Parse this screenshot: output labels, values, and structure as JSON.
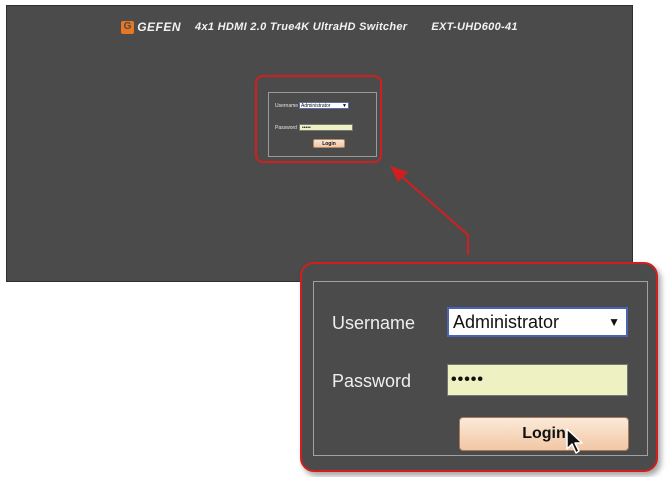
{
  "header": {
    "logo_mark": "G",
    "brand": "GEFEN",
    "product_name": "4x1 HDMI 2.0 True4K UltraHD Switcher",
    "model": "EXT-UHD600-41"
  },
  "login_form": {
    "username_label": "Username",
    "username_value": "Administrator",
    "dropdown_arrow": "▼",
    "password_label": "Password",
    "password_value": "•••••",
    "login_button": "Login"
  },
  "colors": {
    "background": "#4b4b4b",
    "highlight": "#d11f1f",
    "brand_orange": "#e87722",
    "password_field": "#eef2c2",
    "button": "#f2c7a5"
  },
  "icons": [
    "gefen-logo-icon",
    "dropdown-arrow-icon",
    "mouse-pointer-icon"
  ]
}
